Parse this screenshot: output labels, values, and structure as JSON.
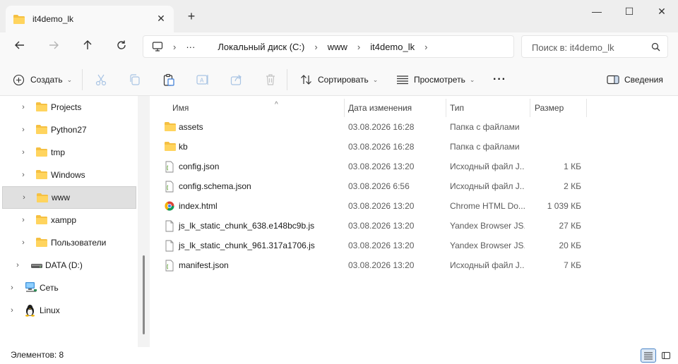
{
  "titlebar": {
    "tab_title": "it4demo_lk",
    "new_tab_symbol": "+",
    "close_symbol": "✕",
    "win_minimize": "—",
    "win_maximize": "☐",
    "win_close": "✕"
  },
  "nav": {
    "back_icon": "arrow-left-icon",
    "forward_icon": "arrow-right-icon",
    "up_icon": "arrow-up-icon",
    "refresh_icon": "refresh-icon",
    "breadcrumbs": [
      "Локальный диск (C:)",
      "www",
      "it4demo_lk"
    ],
    "overflow": "···",
    "search_placeholder": "Поиск в: it4demo_lk"
  },
  "commandbar": {
    "create_label": "Создать",
    "sort_label": "Сортировать",
    "view_label": "Просмотреть",
    "more_label": "···",
    "details_label": "Сведения"
  },
  "sidebar": {
    "items": [
      {
        "label": "Projects",
        "type": "folder"
      },
      {
        "label": "Python27",
        "type": "folder"
      },
      {
        "label": "tmp",
        "type": "folder"
      },
      {
        "label": "Windows",
        "type": "folder"
      },
      {
        "label": "www",
        "type": "folder",
        "selected": true
      },
      {
        "label": "xampp",
        "type": "folder"
      },
      {
        "label": "Пользователи",
        "type": "folder"
      },
      {
        "label": "DATA (D:)",
        "type": "drive"
      },
      {
        "label": "Сеть",
        "type": "network"
      },
      {
        "label": "Linux",
        "type": "linux"
      }
    ]
  },
  "filelist": {
    "columns": {
      "name": "Имя",
      "date": "Дата изменения",
      "type": "Тип",
      "size": "Размер"
    },
    "rows": [
      {
        "name": "assets",
        "date": "03.08.2026 16:28",
        "type": "Папка с файлами",
        "size": "",
        "icon": "folder-icon"
      },
      {
        "name": "kb",
        "date": "03.08.2026 16:28",
        "type": "Папка с файлами",
        "size": "",
        "icon": "folder-icon"
      },
      {
        "name": "config.json",
        "date": "03.08.2026 13:20",
        "type": "Исходный файл J...",
        "size": "1 КБ",
        "icon": "json-file-icon"
      },
      {
        "name": "config.schema.json",
        "date": "03.08.2026 6:56",
        "type": "Исходный файл J...",
        "size": "2 КБ",
        "icon": "json-file-icon"
      },
      {
        "name": "index.html",
        "date": "03.08.2026 13:20",
        "type": "Chrome HTML Do...",
        "size": "1 039 КБ",
        "icon": "chrome-html-icon"
      },
      {
        "name": "js_lk_static_chunk_638.e148bc9b.js",
        "date": "03.08.2026 13:20",
        "type": "Yandex Browser JS...",
        "size": "27 КБ",
        "icon": "js-file-icon"
      },
      {
        "name": "js_lk_static_chunk_961.317a1706.js",
        "date": "03.08.2026 13:20",
        "type": "Yandex Browser JS...",
        "size": "20 КБ",
        "icon": "js-file-icon"
      },
      {
        "name": "manifest.json",
        "date": "03.08.2026 13:20",
        "type": "Исходный файл J...",
        "size": "7 КБ",
        "icon": "json-file-icon"
      }
    ]
  },
  "statusbar": {
    "item_count": "Элементов: 8"
  }
}
